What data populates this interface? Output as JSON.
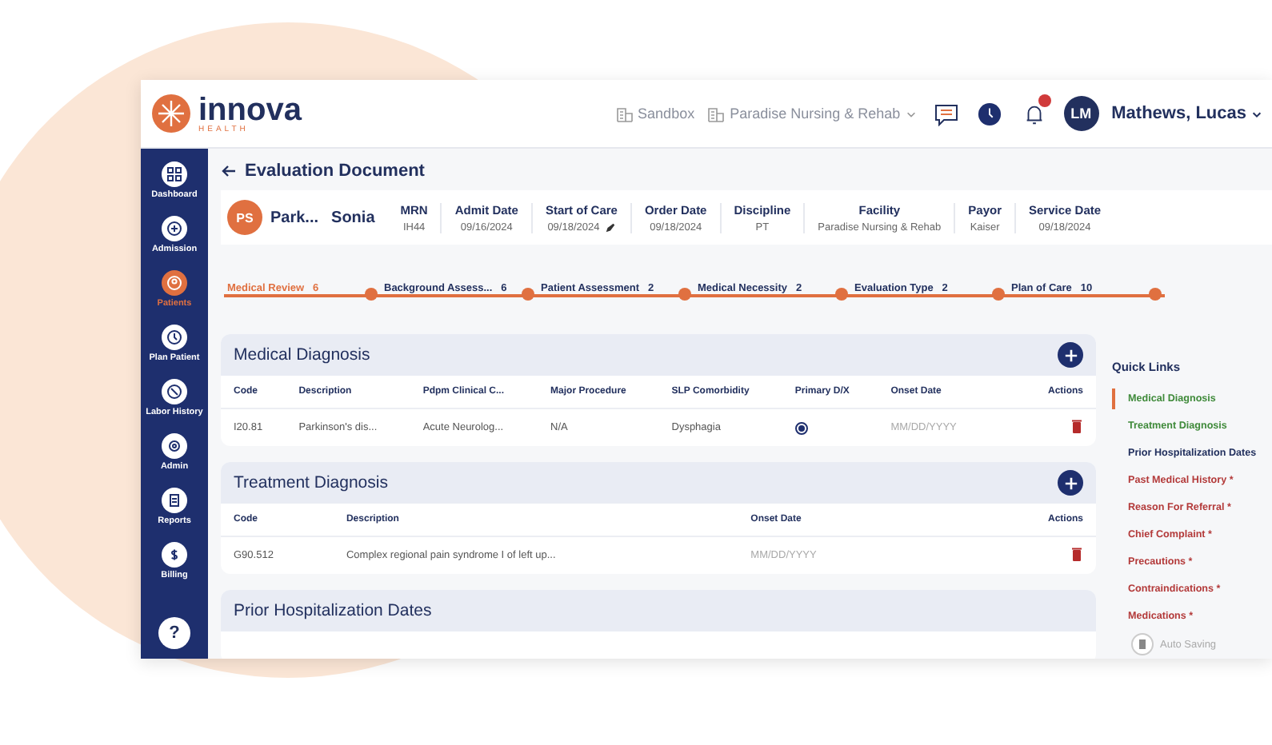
{
  "brand": {
    "name": "innova",
    "tagline": "HEALTH"
  },
  "header": {
    "sandbox": "Sandbox",
    "facility": "Paradise Nursing & Rehab",
    "avatar": "LM",
    "user": "Mathews, Lucas"
  },
  "sidebar": {
    "items": [
      {
        "label": "Dashboard",
        "selected": false
      },
      {
        "label": "Admission",
        "selected": false
      },
      {
        "label": "Patients",
        "selected": true
      },
      {
        "label": "Plan Patient",
        "selected": false
      },
      {
        "label": "Labor History",
        "selected": false
      },
      {
        "label": "Admin",
        "selected": false
      },
      {
        "label": "Reports",
        "selected": false
      },
      {
        "label": "Billing",
        "selected": false
      }
    ],
    "help": "?"
  },
  "page_title": "Evaluation Document",
  "patient": {
    "initials": "PS",
    "last_name": "Park...",
    "first_name": "Sonia",
    "fields": [
      {
        "label": "MRN",
        "value": "IH44",
        "editable": false
      },
      {
        "label": "Admit Date",
        "value": "09/16/2024",
        "editable": false
      },
      {
        "label": "Start of Care",
        "value": "09/18/2024",
        "editable": true
      },
      {
        "label": "Order Date",
        "value": "09/18/2024",
        "editable": false
      },
      {
        "label": "Discipline",
        "value": "PT",
        "editable": false
      },
      {
        "label": "Facility",
        "value": "Paradise Nursing & Rehab",
        "editable": false
      },
      {
        "label": "Payor",
        "value": "Kaiser",
        "editable": false
      },
      {
        "label": "Service Date",
        "value": "09/18/2024",
        "editable": false
      }
    ]
  },
  "steps": [
    {
      "label": "Medical Review",
      "count": "6",
      "selected": true
    },
    {
      "label": "Background Assess...",
      "count": "6",
      "selected": false
    },
    {
      "label": "Patient Assessment",
      "count": "2",
      "selected": false
    },
    {
      "label": "Medical Necessity",
      "count": "2",
      "selected": false
    },
    {
      "label": "Evaluation Type",
      "count": "2",
      "selected": false
    },
    {
      "label": "Plan of Care",
      "count": "10",
      "selected": false
    }
  ],
  "sections": [
    {
      "title": "Medical Diagnosis",
      "columns": [
        "Code",
        "Description",
        "Pdpm Clinical C...",
        "Major Procedure",
        "SLP Comorbidity",
        "Primary D/X",
        "Onset Date",
        "Actions"
      ],
      "rows": [
        {
          "cells": [
            {
              "kind": "text",
              "text": "I20.81"
            },
            {
              "kind": "text",
              "text": "Parkinson's dis..."
            },
            {
              "kind": "text",
              "text": "Acute Neurolog..."
            },
            {
              "kind": "text",
              "text": "N/A"
            },
            {
              "kind": "text",
              "text": "Dysphagia"
            },
            {
              "kind": "radio",
              "checked": true
            },
            {
              "kind": "date",
              "placeholder": "MM/DD/YYYY"
            },
            {
              "kind": "delete"
            }
          ]
        }
      ]
    },
    {
      "title": "Treatment Diagnosis",
      "columns": [
        "Code",
        "Description",
        "Onset Date",
        "",
        "Actions"
      ],
      "rows": [
        {
          "cells": [
            {
              "kind": "text",
              "text": "G90.512"
            },
            {
              "kind": "text",
              "text": "Complex regional pain syndrome I of left up..."
            },
            {
              "kind": "date",
              "placeholder": "MM/DD/YYYY"
            },
            {
              "kind": "empty"
            },
            {
              "kind": "delete"
            }
          ]
        }
      ]
    },
    {
      "title": "Prior Hospitalization Dates"
    }
  ],
  "quick_links": {
    "title": "Quick Links",
    "items": [
      {
        "label": "Medical Diagnosis",
        "color": "#3f8a3a",
        "selected": true
      },
      {
        "label": "Treatment Diagnosis",
        "color": "#3f8a3a",
        "selected": false
      },
      {
        "label": "Prior Hospitalization Dates",
        "color": "#22305e",
        "selected": false
      },
      {
        "label": "Past Medical History *",
        "color": "#b33a3a",
        "selected": false
      },
      {
        "label": "Reason For Referral *",
        "color": "#b33a3a",
        "selected": false
      },
      {
        "label": "Chief Complaint *",
        "color": "#b33a3a",
        "selected": false
      },
      {
        "label": "Precautions *",
        "color": "#b33a3a",
        "selected": false
      },
      {
        "label": "Contraindications *",
        "color": "#b33a3a",
        "selected": false
      },
      {
        "label": "Medications *",
        "color": "#b33a3a",
        "selected": false
      }
    ],
    "auto_save": "Auto Saving"
  }
}
